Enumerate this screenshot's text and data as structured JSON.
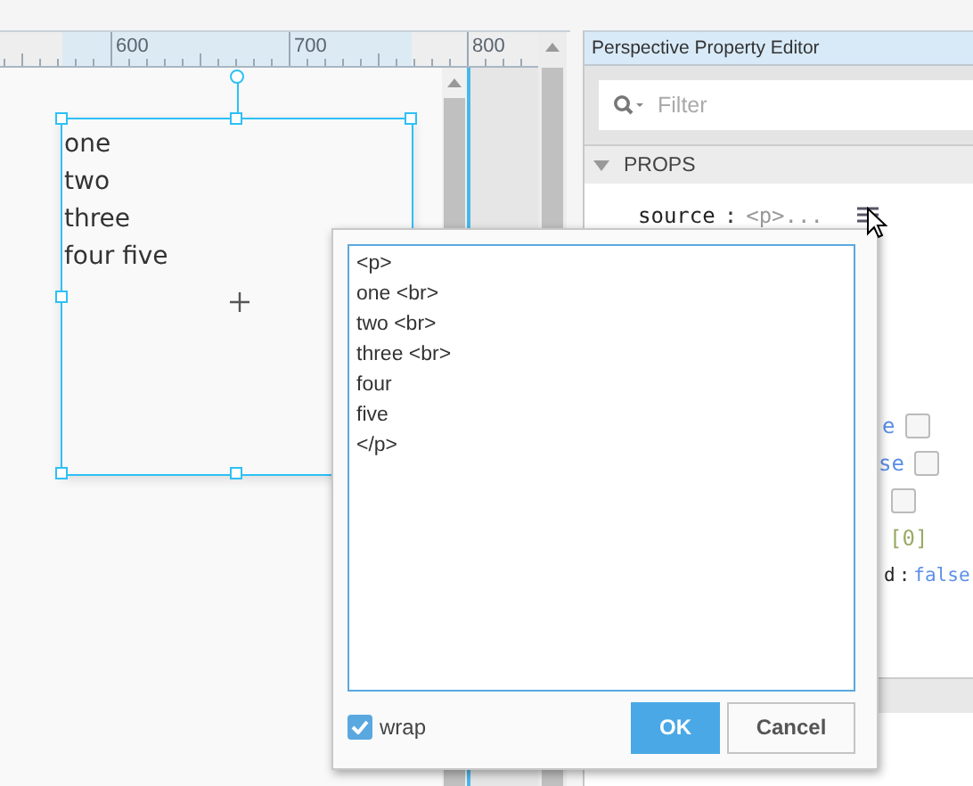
{
  "ruler": {
    "labels": [
      "600",
      "700",
      "800"
    ]
  },
  "component": {
    "lines": [
      "one",
      "two",
      "three",
      "four five"
    ],
    "selected": true
  },
  "panel": {
    "title": "Perspective Property Editor",
    "filter": {
      "placeholder": "Filter"
    },
    "section": {
      "label": "PROPS",
      "expanded": true
    },
    "source": {
      "key": "source",
      "separator": ":",
      "value": "<p>..."
    },
    "rows": [
      {
        "kind": "bool",
        "value": "e",
        "checked": false
      },
      {
        "kind": "bool",
        "value": "se",
        "checked": false
      },
      {
        "kind": "bool",
        "checked": false
      },
      {
        "kind": "array",
        "value": "[0]"
      },
      {
        "kind": "prop",
        "key": "d",
        "separator": ":",
        "value": "false"
      }
    ]
  },
  "dialog": {
    "text": "<p>\none <br>\ntwo <br>\nthree <br>\nfour\nfive\n</p>",
    "wrap": true,
    "wrap_label": "wrap",
    "buttons": [
      {
        "label": "OK",
        "primary": true
      },
      {
        "label": "Cancel",
        "primary": false
      }
    ]
  }
}
